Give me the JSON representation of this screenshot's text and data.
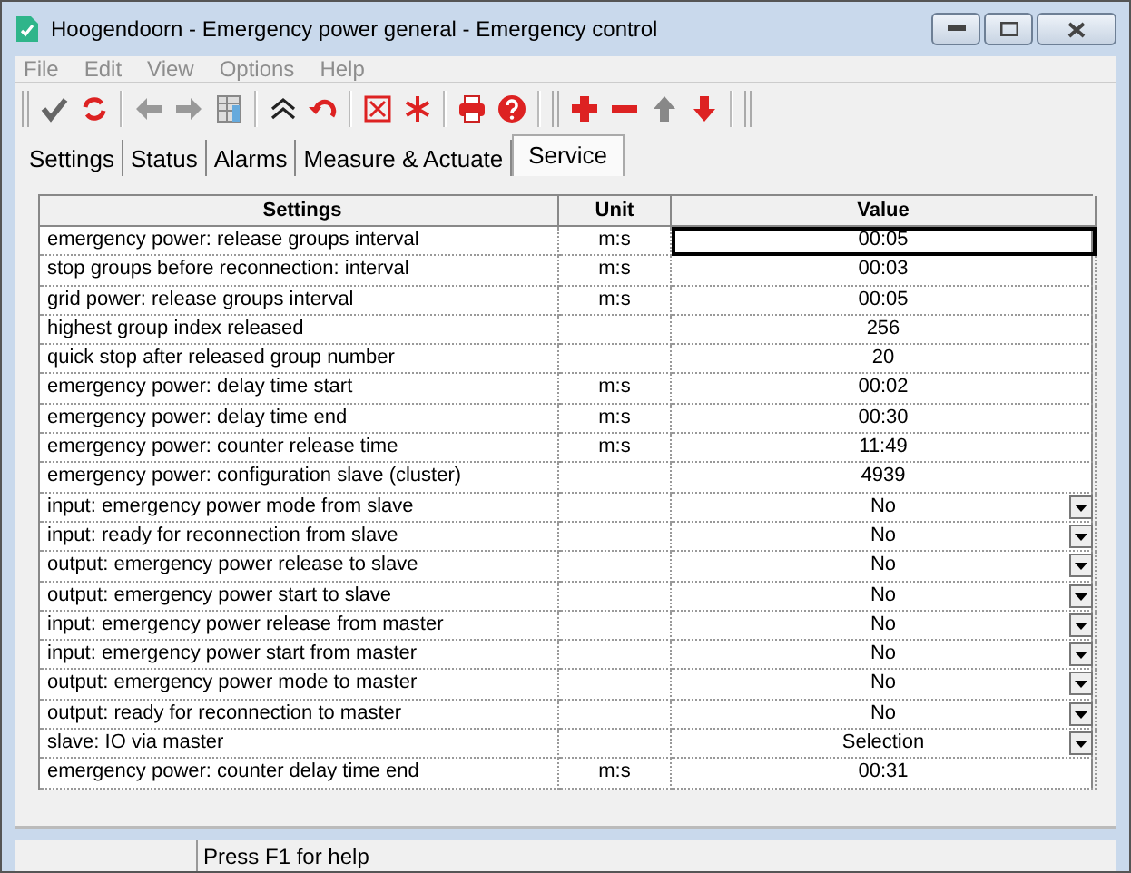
{
  "window": {
    "title": "Hoogendoorn - Emergency power general - Emergency control"
  },
  "menu": [
    {
      "label": "File",
      "disabled": true
    },
    {
      "label": "Edit",
      "disabled": true
    },
    {
      "label": "View",
      "disabled": true
    },
    {
      "label": "Options",
      "disabled": true
    },
    {
      "label": "Help",
      "disabled": true
    }
  ],
  "tabs": [
    {
      "label": "Settings",
      "selected": false
    },
    {
      "label": "Status",
      "selected": false
    },
    {
      "label": "Alarms",
      "selected": false
    },
    {
      "label": "Measure & Actuate",
      "selected": false
    },
    {
      "label": "Service",
      "selected": true
    }
  ],
  "table": {
    "columns": [
      "Settings",
      "Unit",
      "Value"
    ],
    "rows": [
      {
        "setting": "emergency power: release groups interval",
        "unit": "m:s",
        "value": "00:05",
        "kind": "text",
        "selected": true
      },
      {
        "setting": "stop groups before reconnection: interval",
        "unit": "m:s",
        "value": "00:03",
        "kind": "text",
        "selected": false
      },
      {
        "setting": "grid power: release groups interval",
        "unit": "m:s",
        "value": "00:05",
        "kind": "text",
        "selected": false
      },
      {
        "setting": "highest group index released",
        "value": "256",
        "kind": "text",
        "selected": false
      },
      {
        "setting": "quick stop after released group number",
        "value": "20",
        "kind": "text",
        "selected": false
      },
      {
        "setting": "emergency power: delay time start",
        "unit": "m:s",
        "value": "00:02",
        "kind": "text",
        "selected": false
      },
      {
        "setting": "emergency power: delay time end",
        "unit": "m:s",
        "value": "00:30",
        "kind": "text",
        "selected": false
      },
      {
        "setting": "emergency power: counter release time",
        "unit": "m:s",
        "value": "11:49",
        "kind": "text",
        "selected": false
      },
      {
        "setting": "emergency power: configuration slave (cluster)",
        "value": "4939",
        "kind": "text",
        "selected": false
      },
      {
        "setting": "input: emergency power mode from slave",
        "value": "No",
        "kind": "dropdown",
        "selected": false
      },
      {
        "setting": "input: ready for reconnection from slave",
        "value": "No",
        "kind": "dropdown",
        "selected": false
      },
      {
        "setting": "output: emergency power release to slave",
        "value": "No",
        "kind": "dropdown",
        "selected": false
      },
      {
        "setting": "output: emergency power start to slave",
        "value": "No",
        "kind": "dropdown",
        "selected": false
      },
      {
        "setting": "input: emergency power release from master",
        "value": "No",
        "kind": "dropdown",
        "selected": false
      },
      {
        "setting": "input: emergency power start from master",
        "value": "No",
        "kind": "dropdown",
        "selected": false
      },
      {
        "setting": "output: emergency power mode to master",
        "value": "No",
        "kind": "dropdown",
        "selected": false
      },
      {
        "setting": "output: ready for reconnection to master",
        "value": "No",
        "kind": "dropdown",
        "selected": false
      },
      {
        "setting": "slave: IO via master",
        "value": "Selection",
        "kind": "dropdown",
        "selected": false
      },
      {
        "setting": "emergency power: counter delay time end",
        "unit": "m:s",
        "value": "00:31",
        "kind": "text",
        "selected": false
      }
    ]
  },
  "status_bar": {
    "text": "Press F1 for help"
  }
}
